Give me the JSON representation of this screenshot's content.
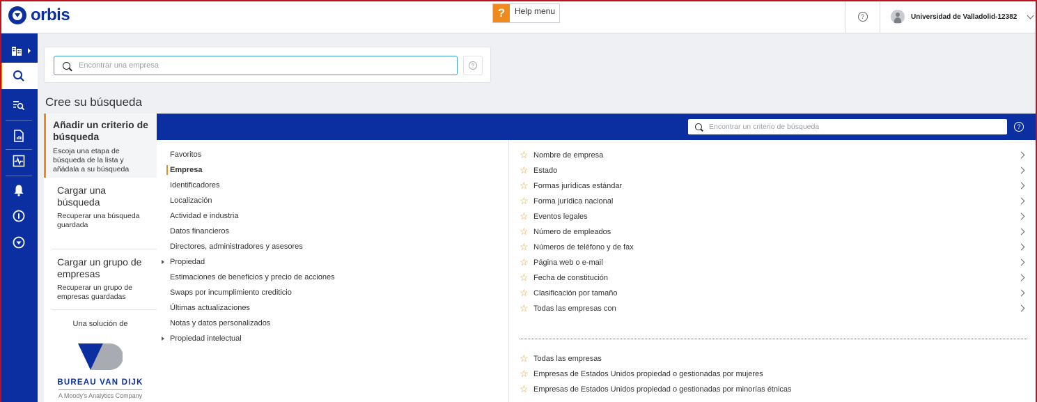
{
  "app": {
    "name": "orbis"
  },
  "help": {
    "label": "Help menu",
    "badge": "?"
  },
  "header": {
    "help_badge": "?",
    "user_name": "Universidad de Valladolid-12382"
  },
  "sidebar": {
    "items": [
      {
        "icon": "building-icon"
      },
      {
        "icon": "search-icon"
      },
      {
        "icon": "list-search-icon"
      },
      {
        "icon": "report-icon"
      },
      {
        "icon": "monitor-pulse-icon"
      },
      {
        "icon": "bell-icon"
      },
      {
        "icon": "circle-info-icon"
      },
      {
        "icon": "orbis-logo-icon"
      }
    ]
  },
  "search": {
    "placeholder": "Encontrar una empresa",
    "help_badge": "?"
  },
  "page": {
    "title": "Cree su búsqueda"
  },
  "left_panel": {
    "add": {
      "title": "Añadir un criterio de búsqueda",
      "desc": "Escoja una etapa de búsqueda de la lista y añádala a su búsqueda"
    },
    "load_search": {
      "title": "Cargar una búsqueda",
      "desc": "Recuperar una búsqueda guardada"
    },
    "load_group": {
      "title": "Cargar un grupo de empresas",
      "desc": "Recuperar un grupo de empresas guardadas"
    },
    "vendor": {
      "intro": "Una solución de",
      "name": "BUREAU VAN DIJK",
      "tagline": "A Moody's Analytics Company"
    }
  },
  "criteria_search": {
    "placeholder": "Encontrar un criterio de búsqueda",
    "help_badge": "?"
  },
  "categories": [
    "Favoritos",
    "Empresa",
    "Identificadores",
    "Localización",
    "Actividad e industria",
    "Datos financieros",
    "Directores, administradores y asesores",
    "Propiedad",
    "Estimaciones de beneficios y precio de acciones",
    "Swaps por incumplimiento crediticio",
    "Últimas actualizaciones",
    "Notas y datos personalizados",
    "Propiedad intelectual"
  ],
  "criteria": [
    "Nombre de empresa",
    "Estado",
    "Formas jurídicas estándar",
    "Forma jurídica nacional",
    "Eventos legales",
    "Número de empleados",
    "Números de teléfono y de fax",
    "Página web o e-mail",
    "Fecha de constitución",
    "Clasificación por tamaño",
    "Todas las empresas con"
  ],
  "favorites": [
    "Todas las empresas",
    "Empresas de Estados Unidos propiedad o gestionadas por mujeres",
    "Empresas de Estados Unidos propiedad o gestionadas por minorías étnicas"
  ],
  "colors": {
    "brand": "#0b2fa0",
    "accent": "#f08a1c",
    "star": "#e8a33a"
  }
}
